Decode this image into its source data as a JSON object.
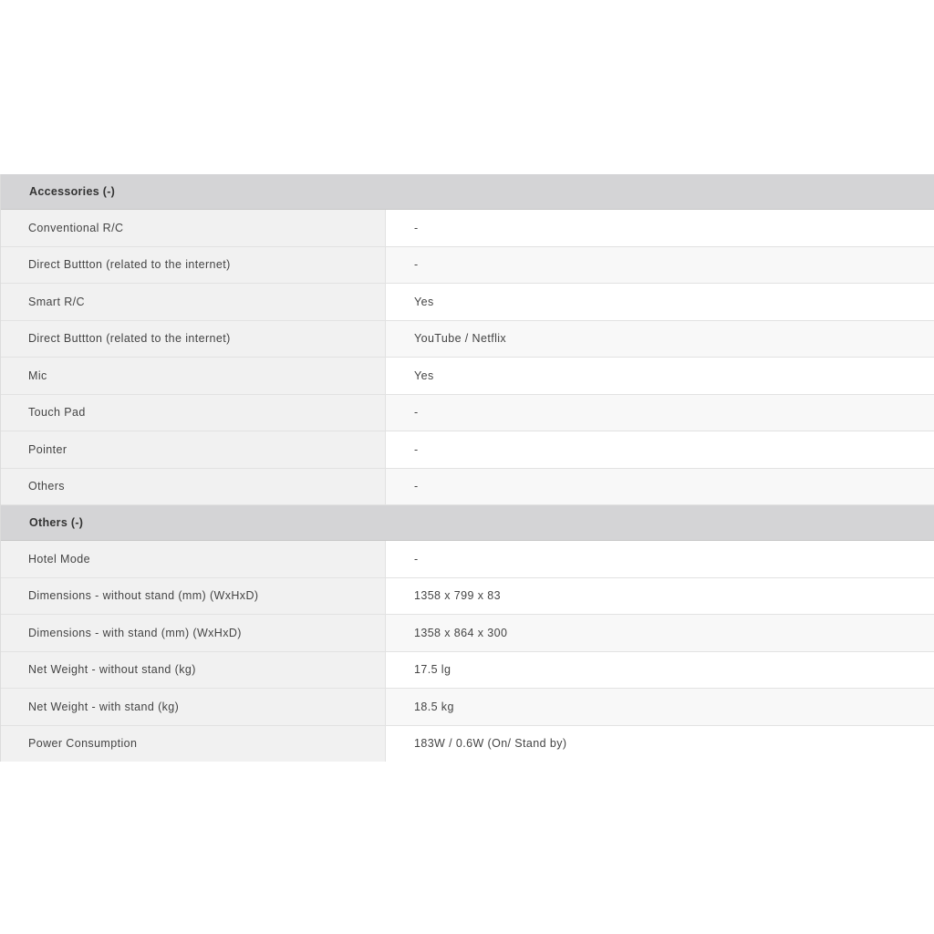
{
  "sections": [
    {
      "title": "Accessories (-)",
      "rows": [
        {
          "label": "Conventional R/C",
          "value": "-"
        },
        {
          "label": "Direct Buttton (related to the internet)",
          "value": "-"
        },
        {
          "label": "Smart R/C",
          "value": "Yes"
        },
        {
          "label": "Direct Buttton (related to the internet)",
          "value": "YouTube / Netflix"
        },
        {
          "label": "Mic",
          "value": "Yes"
        },
        {
          "label": "Touch Pad",
          "value": "-"
        },
        {
          "label": "Pointer",
          "value": "-"
        },
        {
          "label": "Others",
          "value": "-"
        }
      ]
    },
    {
      "title": "Others (-)",
      "rows": [
        {
          "label": "Hotel Mode",
          "value": "-"
        },
        {
          "label": "Dimensions - without stand (mm) (WxHxD)",
          "value": "1358 x 799 x 83"
        },
        {
          "label": "Dimensions - with stand (mm) (WxHxD)",
          "value": "1358 x 864 x 300"
        },
        {
          "label": "Net Weight - without stand (kg)",
          "value": "17.5 lg"
        },
        {
          "label": "Net Weight - with stand (kg)",
          "value": "18.5 kg"
        },
        {
          "label": "Power Consumption",
          "value": "183W / 0.6W (On/ Stand by)"
        }
      ]
    }
  ]
}
